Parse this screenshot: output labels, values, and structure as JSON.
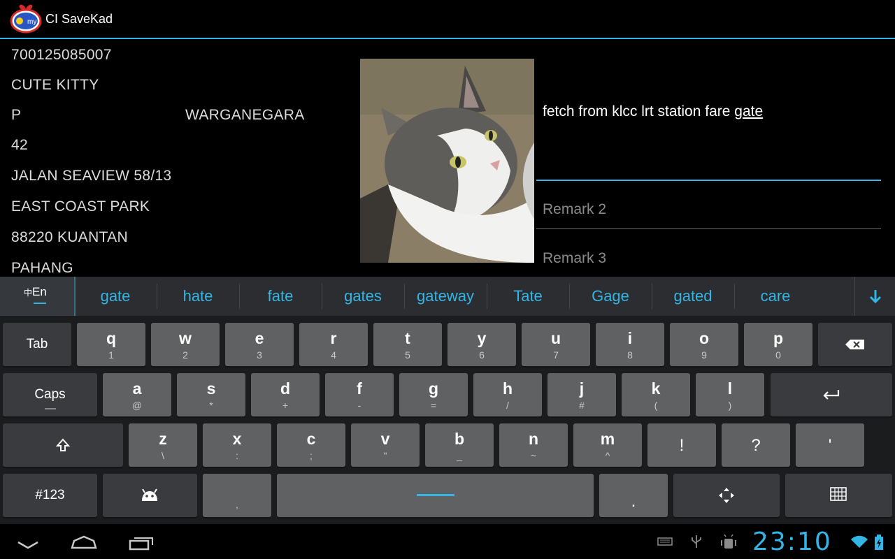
{
  "app": {
    "title": "CI SaveKad",
    "logo_text": "my"
  },
  "record": {
    "id_number": "700125085007",
    "name": "CUTE KITTY",
    "gender": "P",
    "citizenship": "WARGANEGARA",
    "address_line1": "42",
    "address_line2": "JALAN SEAVIEW 58/13",
    "address_line3": "EAST COAST PARK",
    "postcode_city": "88220  KUANTAN",
    "state": "PAHANG"
  },
  "remarks": {
    "remark1_value_prefix": "fetch from klcc lrt station fare ",
    "remark1_value_word": "gate",
    "remark2_placeholder": "Remark 2",
    "remark3_placeholder": "Remark 3"
  },
  "keyboard": {
    "language_switch": {
      "zh": "中",
      "en": "En"
    },
    "suggestions": [
      "gate",
      "hate",
      "fate",
      "gates",
      "gateway",
      "Tate",
      "Gage",
      "gated",
      "care"
    ],
    "row1": [
      {
        "k": "q",
        "s": "1"
      },
      {
        "k": "w",
        "s": "2"
      },
      {
        "k": "e",
        "s": "3"
      },
      {
        "k": "r",
        "s": "4"
      },
      {
        "k": "t",
        "s": "5"
      },
      {
        "k": "y",
        "s": "6"
      },
      {
        "k": "u",
        "s": "7"
      },
      {
        "k": "i",
        "s": "8"
      },
      {
        "k": "o",
        "s": "9"
      },
      {
        "k": "p",
        "s": "0"
      }
    ],
    "row2": [
      {
        "k": "a",
        "s": "@"
      },
      {
        "k": "s",
        "s": "*"
      },
      {
        "k": "d",
        "s": "+"
      },
      {
        "k": "f",
        "s": "-"
      },
      {
        "k": "g",
        "s": "="
      },
      {
        "k": "h",
        "s": "/"
      },
      {
        "k": "j",
        "s": "#"
      },
      {
        "k": "k",
        "s": "("
      },
      {
        "k": "l",
        "s": ")"
      }
    ],
    "row3": [
      {
        "k": "z",
        "s": "\\"
      },
      {
        "k": "x",
        "s": ":"
      },
      {
        "k": "c",
        "s": ";"
      },
      {
        "k": "v",
        "s": "\""
      },
      {
        "k": "b",
        "s": "_"
      },
      {
        "k": "n",
        "s": "~"
      },
      {
        "k": "m",
        "s": "^"
      }
    ],
    "row3_punct": [
      "!",
      "?",
      "'"
    ],
    "tab_label": "Tab",
    "caps_label": "Caps",
    "symbols_label": "#123",
    "comma_label": ",",
    "period_label": "."
  },
  "status": {
    "clock": "23:10"
  },
  "colors": {
    "accent": "#33b5e5",
    "key": "#5f6163",
    "key_dark": "#393b3e",
    "keyboard_bg": "#1b1c1e"
  }
}
